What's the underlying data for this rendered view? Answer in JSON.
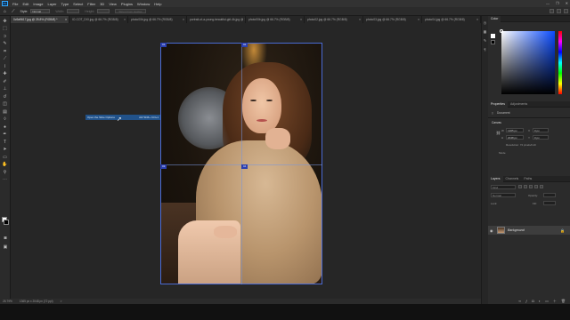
{
  "menubar": {
    "logo": "Ps",
    "items": [
      "File",
      "Edit",
      "Image",
      "Layer",
      "Type",
      "Select",
      "Filter",
      "3D",
      "View",
      "Plugins",
      "Window",
      "Help"
    ],
    "window_controls": [
      "—",
      "❐",
      "✕"
    ]
  },
  "options": {
    "style_label": "Style:",
    "style_value": "Normal",
    "width_label": "Width:",
    "height_label": "Height:",
    "slices_btn": "Slices From Guides"
  },
  "tabs": [
    {
      "label": "0c9a9617.jpg @ 25.8% (RGB/8) *",
      "active": true
    },
    {
      "label": "IO-COT_DXI.jpg @ 66.7% (RGB/8)",
      "active": false
    },
    {
      "label": "photo00b.jpg @ 66.7% (RGB/8)",
      "active": false
    },
    {
      "label": "portrait-of-a-young-beautiful-girl-4k.jpg @ 15.2% (RGB/8)",
      "active": false
    },
    {
      "label": "photo00b.jpg @ 66.7% (RGB/8)",
      "active": false
    },
    {
      "label": "photo02.jpg @ 66.7% (RGB/8)",
      "active": false
    },
    {
      "label": "photo03.jpg @ 66.7% (RGB/8)",
      "active": false
    },
    {
      "label": "photo04.jpg @ 66.7% (RGB/8)",
      "active": false
    }
  ],
  "canvas": {
    "slice_tags": [
      "01",
      "02",
      "03",
      "04"
    ],
    "drag_hint": {
      "left": "Open the Slice Options",
      "right": "Alt/ Shift+ Ctrl+1"
    }
  },
  "statusbar": {
    "zoom": "25.79%",
    "doc": "1365 px x 2048 px (72 ppi)",
    "arrow": ">"
  },
  "panels": {
    "color": {
      "tabs": [
        "Color"
      ]
    },
    "properties": {
      "tabs": [
        "Properties",
        "Adjustments"
      ],
      "doc_label": "Document",
      "canvas_label": "Canvas",
      "w_label": "W",
      "w_value": "1365 px",
      "h_label": "H",
      "h_value": "2048 px",
      "x_label": "X",
      "x_value": "0 px",
      "y_label": "Y",
      "y_value": "0 px",
      "resolution": "Resolution: 72 pixels/inch",
      "mode_label": "Mode"
    },
    "layers": {
      "tabs": [
        "Layers",
        "Channels",
        "Paths"
      ],
      "kind": "Kind",
      "blend": "Normal",
      "opacity_label": "Opacity:",
      "lock_label": "Lock:",
      "fill_label": "Fill:",
      "layer_name": "Background"
    }
  },
  "colors": {
    "accent": "#31a8ff",
    "selection_blue": "#21528a",
    "slice_blue": "#2a3fb0",
    "fg": "#ffffff",
    "bg": "#000000"
  }
}
